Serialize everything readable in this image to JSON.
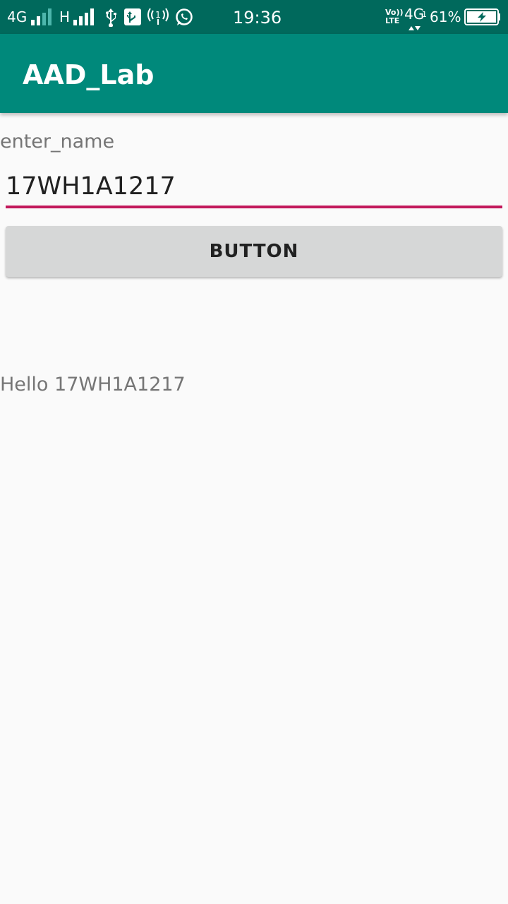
{
  "status_bar": {
    "network1_label": "4G",
    "network2_label": "H",
    "volte_label_top": "Vo))",
    "volte_label_bottom": "LTE",
    "network3_label": "4G",
    "network3_sub": "1",
    "time": "19:36",
    "battery_percent": "61%",
    "battery_level": 0.61,
    "icons": [
      "signal-icon",
      "signal-icon",
      "usb-icon",
      "usb-debug-icon",
      "hotspot-icon",
      "whatsapp-icon",
      "battery-charging-icon"
    ]
  },
  "app_bar": {
    "title": "AAD_Lab",
    "color": "#00897b"
  },
  "form": {
    "label": "enter_name",
    "input_value": "17WH1A1217",
    "underline_color": "#c2185b",
    "button_label": "BUTTON"
  },
  "output": {
    "greeting": "Hello 17WH1A1217"
  }
}
